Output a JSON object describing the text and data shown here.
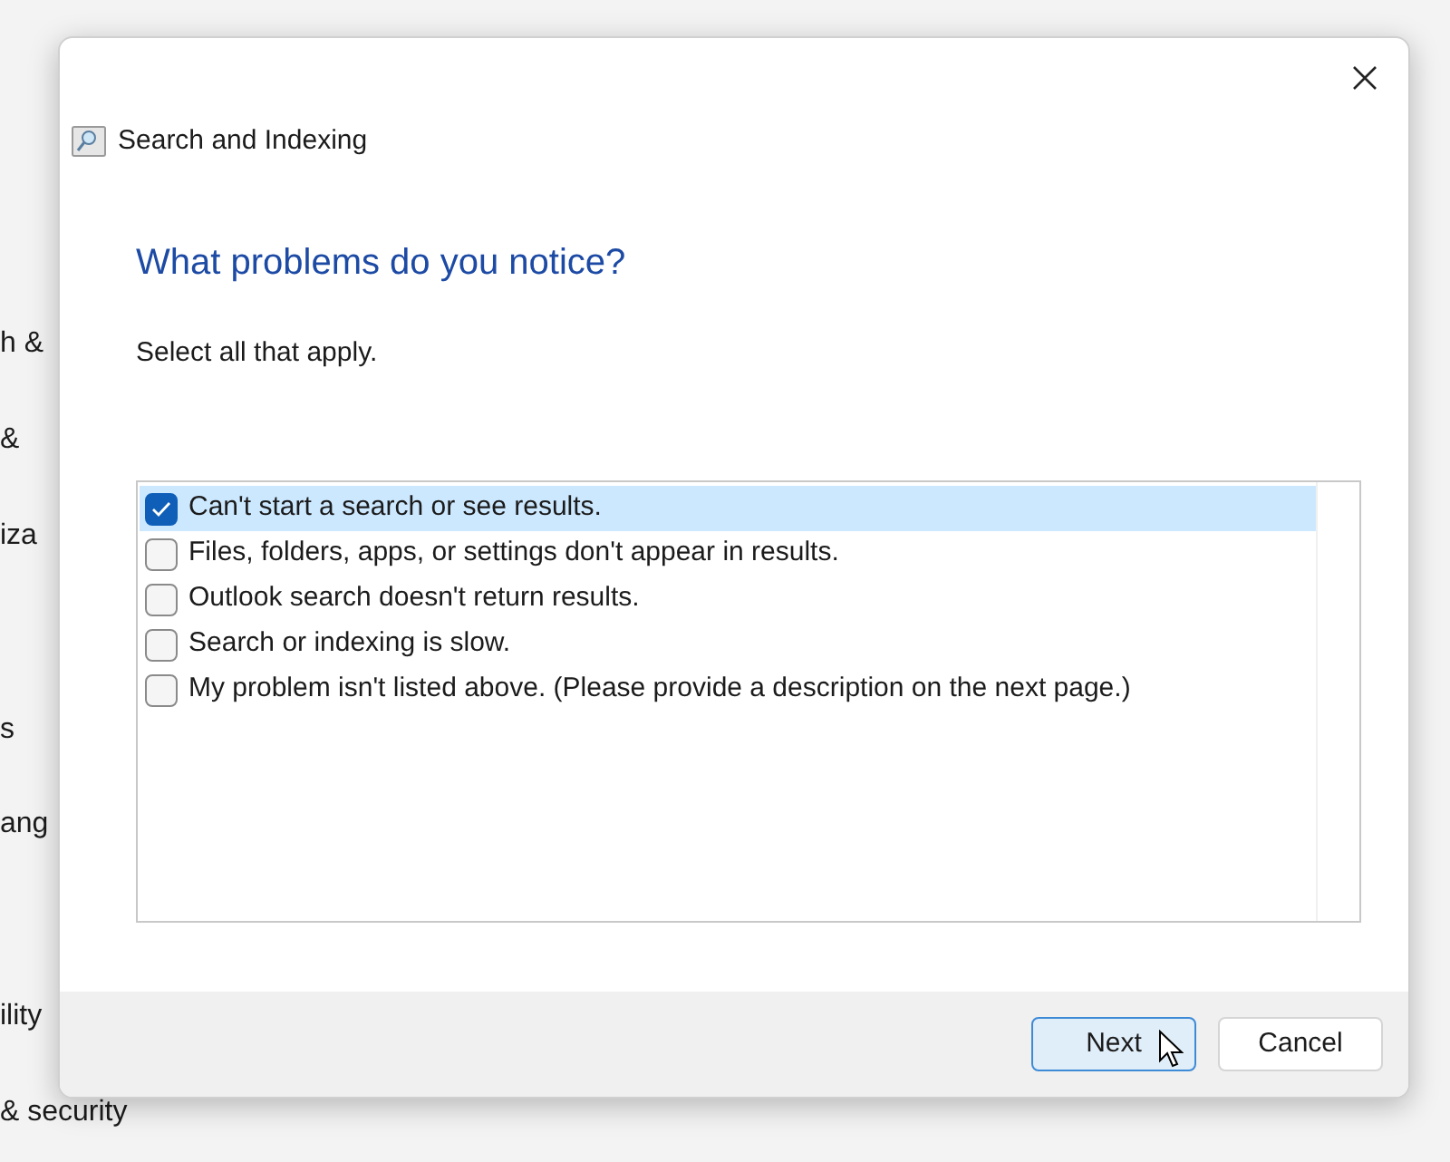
{
  "background_fragments": [
    "h &",
    "&",
    "iza",
    "s",
    "ang",
    "ility",
    "& security"
  ],
  "window": {
    "title": "Search and Indexing"
  },
  "heading": "What problems do you notice?",
  "instruction": "Select all that apply.",
  "problems": [
    {
      "label": "Can't start a search or see results.",
      "checked": true,
      "selected": true
    },
    {
      "label": "Files, folders, apps, or settings don't appear in results.",
      "checked": false,
      "selected": false
    },
    {
      "label": "Outlook search doesn't return results.",
      "checked": false,
      "selected": false
    },
    {
      "label": "Search or indexing is slow.",
      "checked": false,
      "selected": false
    },
    {
      "label": "My problem isn't listed above. (Please provide a description on the next page.)",
      "checked": false,
      "selected": false
    }
  ],
  "buttons": [
    {
      "label": "Next",
      "default": true
    },
    {
      "label": "Cancel",
      "default": false
    }
  ]
}
